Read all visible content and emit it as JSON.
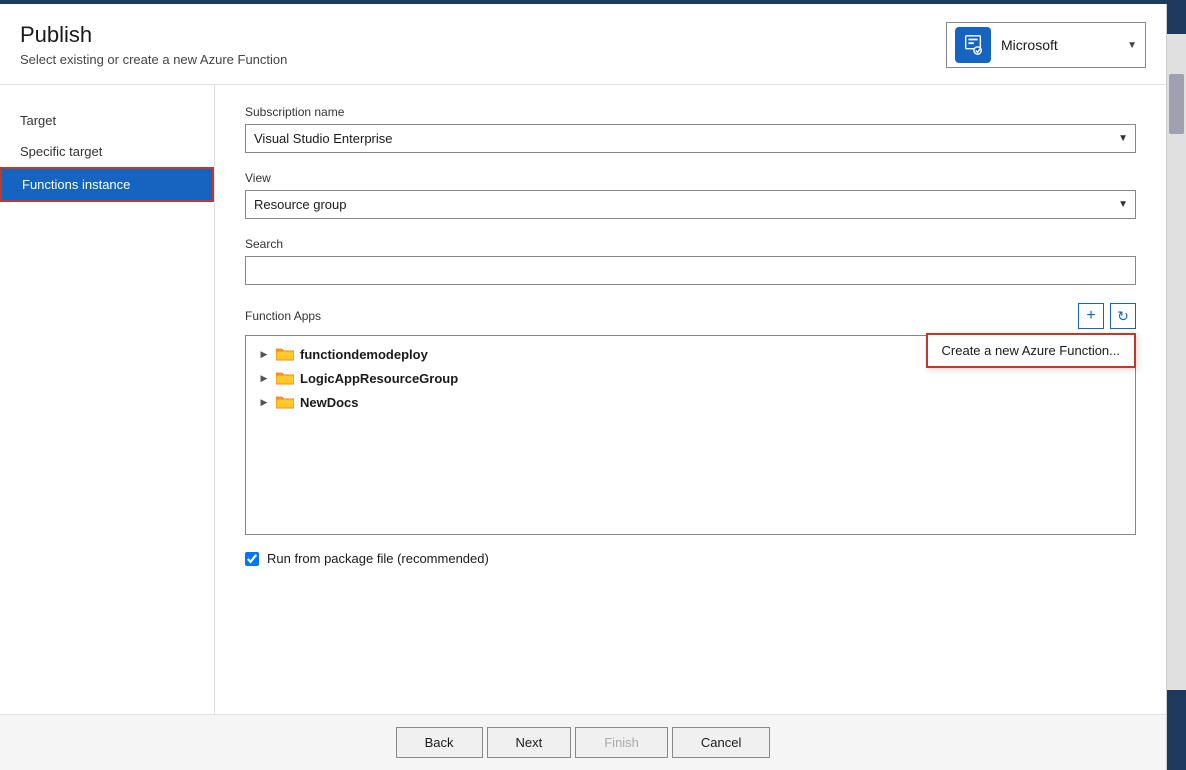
{
  "header": {
    "title": "Publish",
    "subtitle": "Select existing or create a new Azure Function",
    "account": {
      "name": "Microsoft",
      "icon_label": "user-account-icon"
    }
  },
  "nav": {
    "items": [
      {
        "id": "target",
        "label": "Target"
      },
      {
        "id": "specific-target",
        "label": "Specific target"
      },
      {
        "id": "functions-instance",
        "label": "Functions instance",
        "active": true
      }
    ]
  },
  "form": {
    "subscription_label": "Subscription name",
    "subscription_value": "Visual Studio Enterprise",
    "view_label": "View",
    "view_value": "Resource group",
    "search_label": "Search",
    "search_placeholder": "",
    "function_apps_label": "Function Apps",
    "create_tooltip": "Create a new Azure Function...",
    "tree_items": [
      {
        "label": "functiondemodeploy"
      },
      {
        "label": "LogicAppResourceGroup"
      },
      {
        "label": "NewDocs"
      }
    ],
    "checkbox_label": "Run from package file (recommended)",
    "checkbox_checked": true
  },
  "buttons": {
    "back": "Back",
    "next": "Next",
    "finish": "Finish",
    "cancel": "Cancel"
  },
  "icons": {
    "folder": "folder-icon",
    "expand": "▶",
    "plus": "+",
    "refresh": "↻",
    "dropdown_arrow": "▼"
  }
}
